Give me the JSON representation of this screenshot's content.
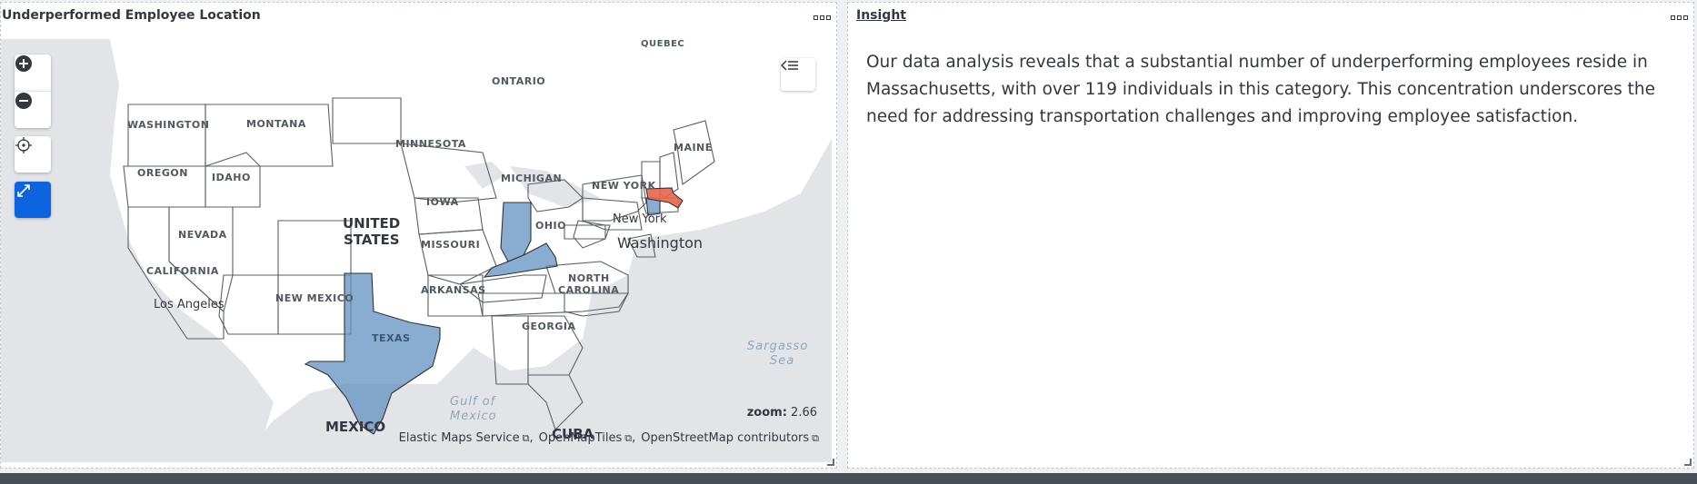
{
  "map_panel": {
    "title": "Underperformed Employee Location",
    "zoom_label": "zoom:",
    "zoom_value": "2.66",
    "attribution": [
      "Elastic Maps Service",
      "OpenMapTiles",
      "OpenStreetMap contributors"
    ],
    "controls": [
      "plus-icon",
      "minus-icon",
      "crosshair-icon",
      "expand-icon",
      "layers-collapse-icon"
    ],
    "labels": {
      "quebec": "QUEBEC",
      "ontario": "ONTARIO",
      "washington": "WASHINGTON",
      "montana": "MONTANA",
      "minnesota": "MINNESOTA",
      "maine": "MAINE",
      "oregon": "OREGON",
      "idaho": "IDAHO",
      "michigan": "MICHIGAN",
      "new_york": "NEW YORK",
      "iowa": "IOWA",
      "united": "UNITED",
      "states": "STATES",
      "nevada": "NEVADA",
      "new_york_city": "New York",
      "ohio": "OHIO",
      "washington_dc": "Washington",
      "missouri": "MISSOURI",
      "california": "CALIFORNIA",
      "north": "NORTH",
      "carolina": "CAROLINA",
      "arkansas": "ARKANSAS",
      "los_angeles": "Los Angeles",
      "new_mexico": "NEW MEXICO",
      "georgia": "GEORGIA",
      "texas": "TEXAS",
      "sargasso": "Sargasso",
      "sea": "Sea",
      "gulf": "Gulf of",
      "mexico_water": "Mexico",
      "mexico": "MEXICO",
      "cuba": "CUBA"
    },
    "colors": {
      "high": "#e7664c",
      "medium": "#6092c0"
    }
  },
  "insight_panel": {
    "title": "Insight",
    "text": "Our data analysis reveals that a substantial number of underperforming employees reside in Massachusetts, with over 119 individuals in this category. This concentration underscores the need for addressing transportation challenges and improving employee satisfaction."
  }
}
